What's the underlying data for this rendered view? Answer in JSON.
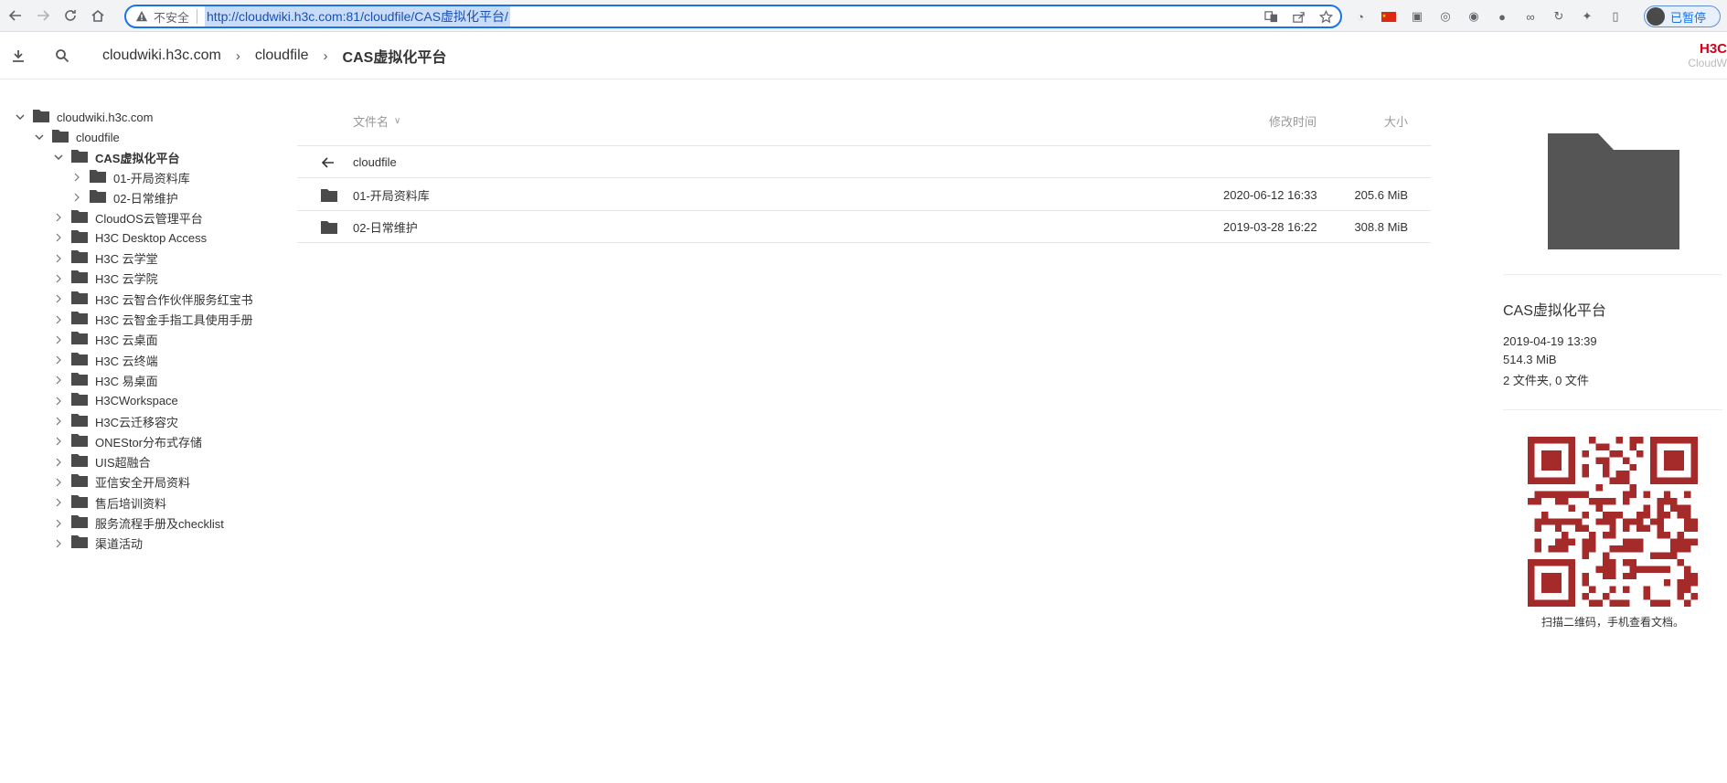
{
  "browser": {
    "insecure_label": "不安全",
    "url": "http://cloudwiki.h3c.com:81/cloudfile/CAS虚拟化平台/",
    "pause_label": "已暂停"
  },
  "breadcrumb": {
    "items": [
      "cloudwiki.h3c.com",
      "cloudfile",
      "CAS虚拟化平台"
    ]
  },
  "brand": {
    "line1": "H3C",
    "line2": "CloudW"
  },
  "tree": {
    "root": "cloudwiki.h3c.com",
    "level1": "cloudfile",
    "current": "CAS虚拟化平台",
    "current_children": [
      "01-开局资料库",
      "02-日常维护"
    ],
    "siblings": [
      "CloudOS云管理平台",
      "H3C Desktop Access",
      "H3C 云学堂",
      "H3C 云学院",
      "H3C 云智合作伙伴服务红宝书",
      "H3C 云智金手指工具使用手册",
      "H3C 云桌面",
      "H3C 云终端",
      "H3C 易桌面",
      "H3CWorkspace",
      "H3C云迁移容灾",
      "ONEStor分布式存储",
      "UIS超融合",
      "亚信安全开局资料",
      "售后培训资料",
      "服务流程手册及checklist",
      "渠道活动"
    ]
  },
  "list": {
    "col_name": "文件名",
    "col_modified": "修改时间",
    "col_size": "大小",
    "parent": "cloudfile",
    "rows": [
      {
        "name": "01-开局资料库",
        "modified": "2020-06-12 16:33",
        "size": "205.6 MiB"
      },
      {
        "name": "02-日常维护",
        "modified": "2019-03-28 16:22",
        "size": "308.8 MiB"
      }
    ]
  },
  "panel": {
    "title": "CAS虚拟化平台",
    "modified": "2019-04-19 13:39",
    "size": "514.3 MiB",
    "counts": "2 文件夹, 0 文件",
    "qr_caption": "扫描二维码，手机查看文档。"
  },
  "colors": {
    "folder": "#555555",
    "qr": "#a52a2a",
    "accent": "#1a73e8",
    "brand": "#d0021b"
  }
}
